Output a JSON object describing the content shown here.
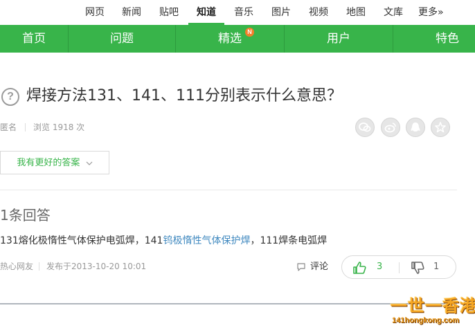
{
  "topnav": {
    "items": [
      "网页",
      "新闻",
      "贴吧",
      "知道",
      "音乐",
      "图片",
      "视频",
      "地图",
      "文库",
      "更多»"
    ],
    "active_index": 3
  },
  "menu": {
    "items": [
      "首页",
      "问题",
      "精选",
      "用户",
      "特色"
    ],
    "badge": "N",
    "accent": "#38b44a"
  },
  "question": {
    "icon": "question-circle-icon",
    "title": "焊接方法131、141、111分别表示什么意思？",
    "author": "匿名",
    "views": "浏览 1918 次"
  },
  "share_icons": [
    "wechat-icon",
    "weibo-icon",
    "qq-icon",
    "star-icon"
  ],
  "better_answer_button": "我有更好的答案",
  "answers": {
    "count_title": "1条回答",
    "items": [
      {
        "text_before": "131熔化极惰性气体保护电弧焊，141",
        "link_text": "钨极惰性气体保护焊",
        "text_after": "，111焊条电弧焊",
        "author": "热心网友",
        "published": "发布于2013-10-20 10:01",
        "comment_label": "评论",
        "upvotes": "3",
        "downvotes": "1"
      }
    ]
  },
  "watermark": {
    "main": "一世一香港",
    "url": "141hongkong.com"
  }
}
